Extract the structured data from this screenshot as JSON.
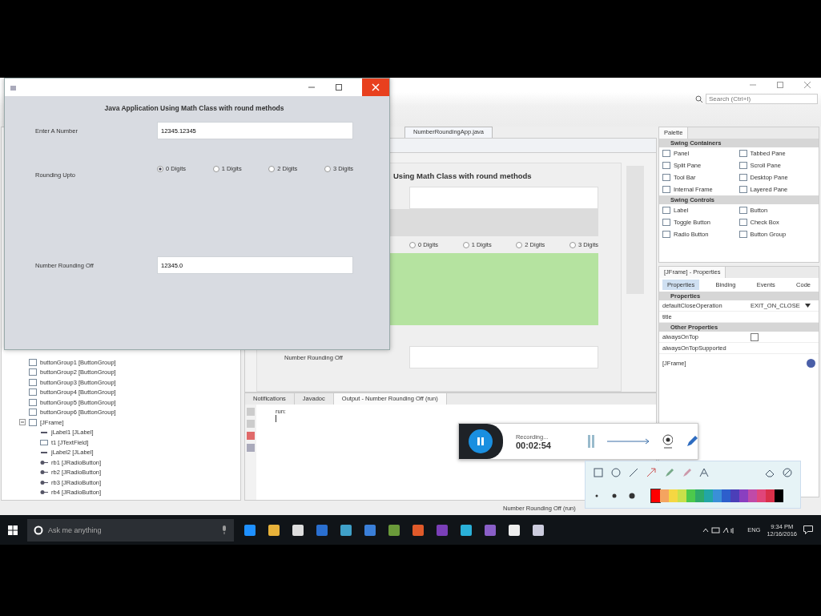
{
  "ide": {
    "search": {
      "placeholder": "Search (Ctrl+I)"
    },
    "editor_tab": {
      "label": "NumberRoundingApp.java"
    },
    "designer": {
      "heading": "Using Math Class with round methods",
      "radios": [
        {
          "label": "0 Digits",
          "selected": false
        },
        {
          "label": "1 Digits",
          "selected": false
        },
        {
          "label": "2 Digits",
          "selected": false
        },
        {
          "label": "3 Digits",
          "selected": false
        }
      ],
      "result_label": "Number Rounding Off"
    },
    "navigator": [
      {
        "label": "buttonGroup1 [ButtonGroup]"
      },
      {
        "label": "buttonGroup2 [ButtonGroup]"
      },
      {
        "label": "buttonGroup3 [ButtonGroup]"
      },
      {
        "label": "buttonGroup4 [ButtonGroup]"
      },
      {
        "label": "buttonGroup5 [ButtonGroup]"
      },
      {
        "label": "buttonGroup6 [ButtonGroup]"
      },
      {
        "label": "[JFrame]",
        "expanded": true,
        "children": [
          {
            "label": "jLabel1 [JLabel]",
            "kind": "label"
          },
          {
            "label": "t1 [JTextField]",
            "kind": "field"
          },
          {
            "label": "jLabel2 [JLabel]",
            "kind": "label"
          },
          {
            "label": "rb1 [JRadioButton]",
            "kind": "radio"
          },
          {
            "label": "rb2 [JRadioButton]",
            "kind": "radio"
          },
          {
            "label": "rb3 [JRadioButton]",
            "kind": "radio"
          },
          {
            "label": "rb4 [JRadioButton]",
            "kind": "radio"
          }
        ]
      }
    ],
    "palette": {
      "title": "Palette",
      "sections": [
        {
          "title": "Swing Containers",
          "items": [
            "Panel",
            "Tabbed Pane",
            "Split Pane",
            "Scroll Pane",
            "Tool Bar",
            "Desktop Pane",
            "Internal Frame",
            "Layered Pane"
          ]
        },
        {
          "title": "Swing Controls",
          "items": [
            "Label",
            "Button",
            "Toggle Button",
            "Check Box",
            "Radio Button",
            "Button Group"
          ]
        }
      ]
    },
    "properties": {
      "title": "[JFrame] - Properties",
      "tabs": [
        {
          "label": "Properties",
          "selected": true
        },
        {
          "label": "Binding",
          "selected": false
        },
        {
          "label": "Events",
          "selected": false
        },
        {
          "label": "Code",
          "selected": false
        }
      ],
      "sections": [
        {
          "title": "Properties",
          "rows": [
            {
              "name": "defaultCloseOperation",
              "kind": "dropdown",
              "value": "EXIT_ON_CLOSE"
            },
            {
              "name": "title",
              "kind": "text"
            }
          ]
        },
        {
          "title": "Other Properties",
          "rows": [
            {
              "name": "alwaysOnTop",
              "kind": "checkbox",
              "checked": false
            },
            {
              "name": "alwaysOnTopSupported",
              "kind": "text"
            }
          ]
        }
      ],
      "footer": "[JFrame]"
    },
    "output": {
      "tabs": [
        {
          "label": "Notifications",
          "selected": false
        },
        {
          "label": "Javadoc",
          "selected": false
        },
        {
          "label": "Output - Number Rounding Off (run)",
          "selected": true
        }
      ],
      "lines": [
        "run:"
      ]
    },
    "status_bar": "Number Rounding Off (run)"
  },
  "app": {
    "heading": "Java Application Using Math Class with round methods",
    "input_label": "Enter A Number",
    "input_value": "12345.12345",
    "radio_label": "Rounding Upto",
    "radios": [
      {
        "label": "0 Digits",
        "selected": true
      },
      {
        "label": "1 Digits",
        "selected": false
      },
      {
        "label": "2 Digits",
        "selected": false
      },
      {
        "label": "3 Digits",
        "selected": false
      }
    ],
    "result_label": "Number Rounding Off",
    "result_value": "12345.0"
  },
  "recorder": {
    "status": "Recording...",
    "time": "00:02:54"
  },
  "draw_palette": {
    "colors": [
      {
        "color": "#ff0000",
        "selected": true
      },
      {
        "color": "#f4a460",
        "selected": false
      },
      {
        "color": "#f5d742",
        "selected": false
      },
      {
        "color": "#c8e04a",
        "selected": false
      },
      {
        "color": "#4cc94c",
        "selected": false
      },
      {
        "color": "#2eaa6a",
        "selected": false
      },
      {
        "color": "#22a6a6",
        "selected": false
      },
      {
        "color": "#3a8fd8",
        "selected": false
      },
      {
        "color": "#2d5fcc",
        "selected": false
      },
      {
        "color": "#4b3fb8",
        "selected": false
      },
      {
        "color": "#8a3fc0",
        "selected": false
      },
      {
        "color": "#c04aa8",
        "selected": false
      },
      {
        "color": "#e0457a",
        "selected": false
      },
      {
        "color": "#d9304a",
        "selected": false
      },
      {
        "color": "#000000",
        "selected": false
      }
    ]
  },
  "taskbar": {
    "search": {
      "placeholder": "Ask me anything"
    },
    "language": "ENG",
    "time": "9:34 PM",
    "date": "12/16/2016"
  }
}
